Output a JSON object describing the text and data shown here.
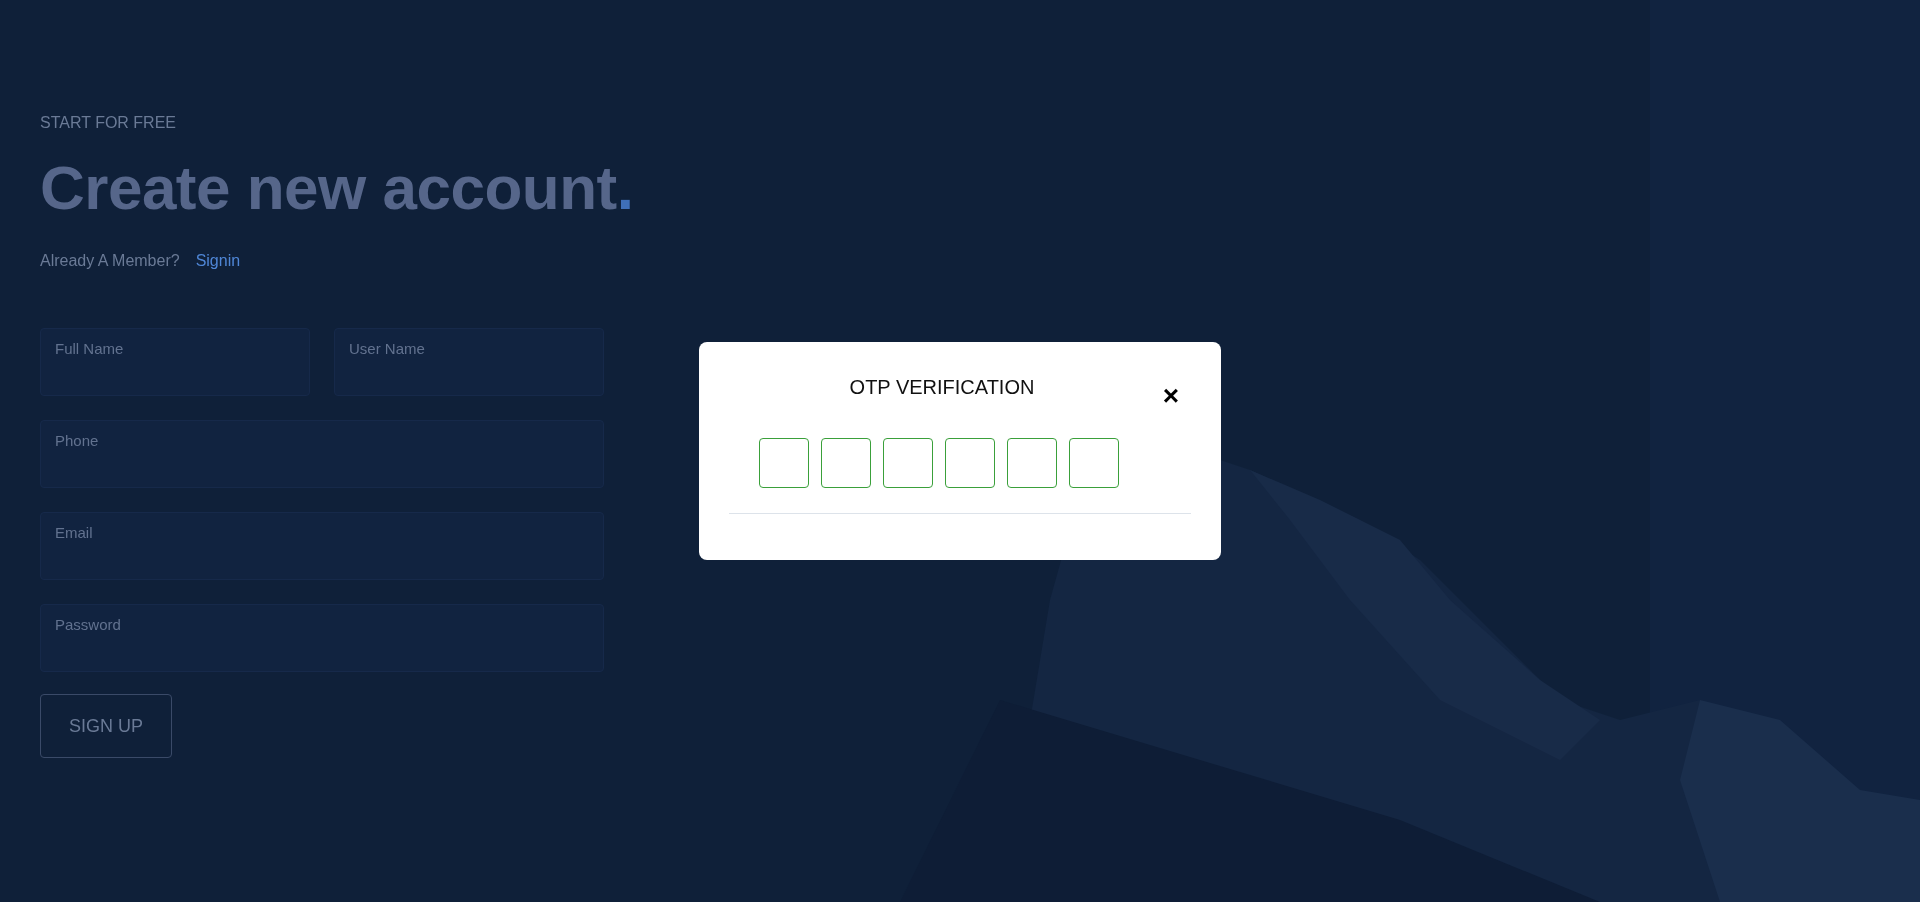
{
  "signup": {
    "eyebrow": "START FOR FREE",
    "title": "Create new account",
    "title_mark": ".",
    "prompt": "Already A Member?",
    "signin_link": "Signin",
    "fields": [
      {
        "kind": "half",
        "placeholder": "Full Name"
      },
      {
        "kind": "half",
        "placeholder": "User Name"
      },
      {
        "kind": "full",
        "placeholder": "Phone"
      },
      {
        "kind": "full",
        "placeholder": "Email"
      },
      {
        "kind": "full",
        "placeholder": "Password"
      }
    ],
    "submit": "SIGN UP"
  },
  "modal": {
    "title": "OTP VERIFICATION",
    "close": "×",
    "digit_fields": [
      {
        "kind": "digit"
      },
      {
        "kind": "digit"
      },
      {
        "kind": "digit"
      },
      {
        "kind": "digit"
      },
      {
        "kind": "digit"
      },
      {
        "kind": "digit"
      }
    ]
  }
}
